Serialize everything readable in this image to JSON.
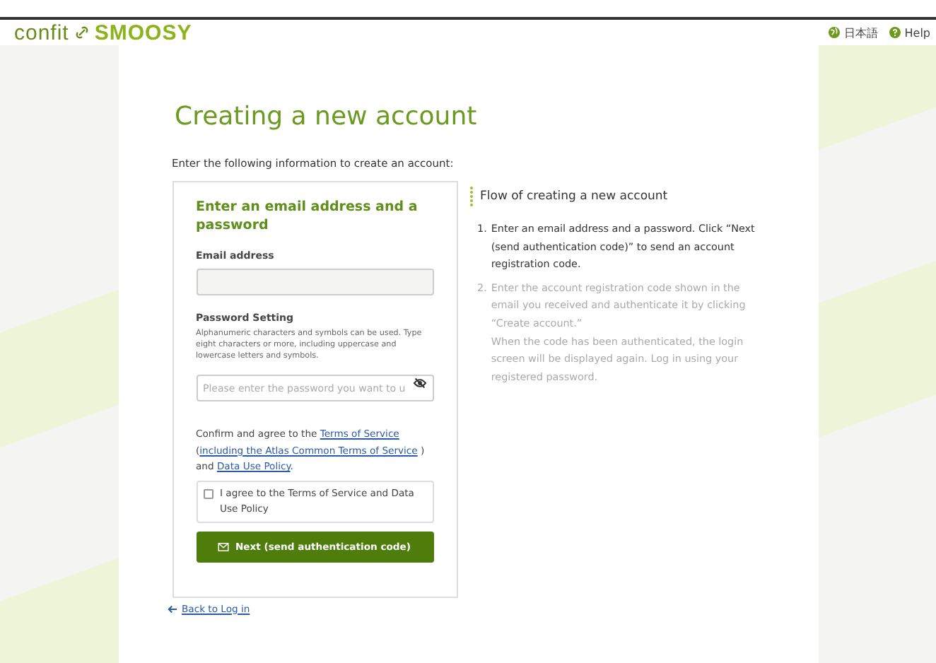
{
  "header": {
    "logo_left": "confit",
    "logo_right": "SMOOSY",
    "links": [
      {
        "label": "日本語",
        "kind": "language"
      },
      {
        "label": "Help",
        "kind": "help"
      }
    ]
  },
  "page": {
    "title": "Creating a new account",
    "intro": "Enter the following information to create an account:"
  },
  "form": {
    "heading": "Enter an email address and a password",
    "email": {
      "label": "Email address"
    },
    "password": {
      "label": "Password Setting",
      "hint": "Alphanumeric characters and symbols can be used. Type eight characters or more, including uppercase and lowercase letters and symbols.",
      "placeholder": "Please enter the password you want to u"
    },
    "terms": {
      "parts": [
        {
          "kind": "text",
          "text": "Confirm and agree to the "
        },
        {
          "kind": "link",
          "text": "Terms of Service"
        },
        {
          "kind": "text",
          "text": " ("
        },
        {
          "kind": "link",
          "text": "including the Atlas Common Terms of Service"
        },
        {
          "kind": "text",
          "text": " ) and "
        },
        {
          "kind": "link",
          "text": "Data Use Policy"
        },
        {
          "kind": "text",
          "text": "."
        }
      ]
    },
    "agree": {
      "label": "I agree to the Terms of Service and Data Use Policy",
      "checked": false
    },
    "submit": "Next (send authentication code)"
  },
  "back_link": "Back to Log in",
  "flow": {
    "title": "Flow of creating a new account",
    "steps": [
      {
        "number": "1.",
        "text": "Enter an email address and a password. Click “Next (send authentication code)” to send an account registration code.",
        "active": true
      },
      {
        "number": "2.",
        "text": "Enter the account registration code shown in the email you received and authenticate it by clicking “Create account.”\nWhen the code has been authenticated, the login screen will be displayed again. Log in using your registered password.",
        "active": false
      }
    ]
  }
}
